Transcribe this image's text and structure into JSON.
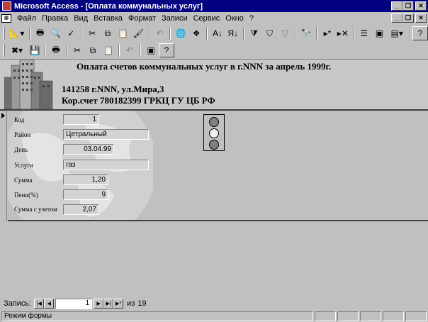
{
  "window": {
    "title": "Microsoft Access - [Оплата коммунальных услуг]",
    "buttons": [
      "_",
      "❐",
      "✕"
    ]
  },
  "menu": {
    "items": [
      "Файл",
      "Правка",
      "Вид",
      "Вставка",
      "Формат",
      "Записи",
      "Сервис",
      "Окно",
      "?"
    ]
  },
  "toolbar1": {
    "icons": [
      "view-design-icon",
      "print-icon",
      "print-preview-icon",
      "spelling-icon",
      "cut-icon",
      "copy-icon",
      "paste-icon",
      "format-painter-icon",
      "undo-icon",
      "insert-hyperlink-icon",
      "web-toolbar-icon",
      "sort-ascending-icon",
      "sort-descending-icon",
      "filter-by-selection-icon",
      "filter-by-form-icon",
      "apply-filter-icon",
      "find-icon",
      "new-record-icon",
      "delete-record-icon",
      "properties-icon",
      "database-window-icon",
      "new-object-icon",
      "help-icon"
    ]
  },
  "toolbar2": {
    "icons": [
      "delete-icon",
      "save-icon",
      "print-icon",
      "cut-icon",
      "copy-icon",
      "paste-icon",
      "undo-icon",
      "database-window-icon",
      "help-icon"
    ]
  },
  "form": {
    "header": {
      "title": "Оплата счетов коммунальных услуг в г.NNN за апрель 1999г.",
      "address": "141258 г.NNN, ул.Мира,3",
      "account": "Кор.счет 780182399 ГРКЦ ГУ ЦБ РФ"
    },
    "fields": {
      "kod": {
        "label": "Код",
        "value": "1"
      },
      "rayon": {
        "label": "Район",
        "value": "Цетральный"
      },
      "den": {
        "label": "День",
        "value": "03.04.99"
      },
      "uslugi": {
        "label": "Услуги",
        "value": "газ"
      },
      "summa": {
        "label": "Сумма",
        "value": "1,20"
      },
      "peni": {
        "label": "Пени(%)",
        "value": "9"
      },
      "summa_uchet": {
        "label": "Сумма с учетом",
        "value": "2,07"
      }
    }
  },
  "navigation": {
    "label": "Запись:",
    "current": "1",
    "of_label": "из",
    "total": "19"
  },
  "status": {
    "text": "Режим формы"
  }
}
